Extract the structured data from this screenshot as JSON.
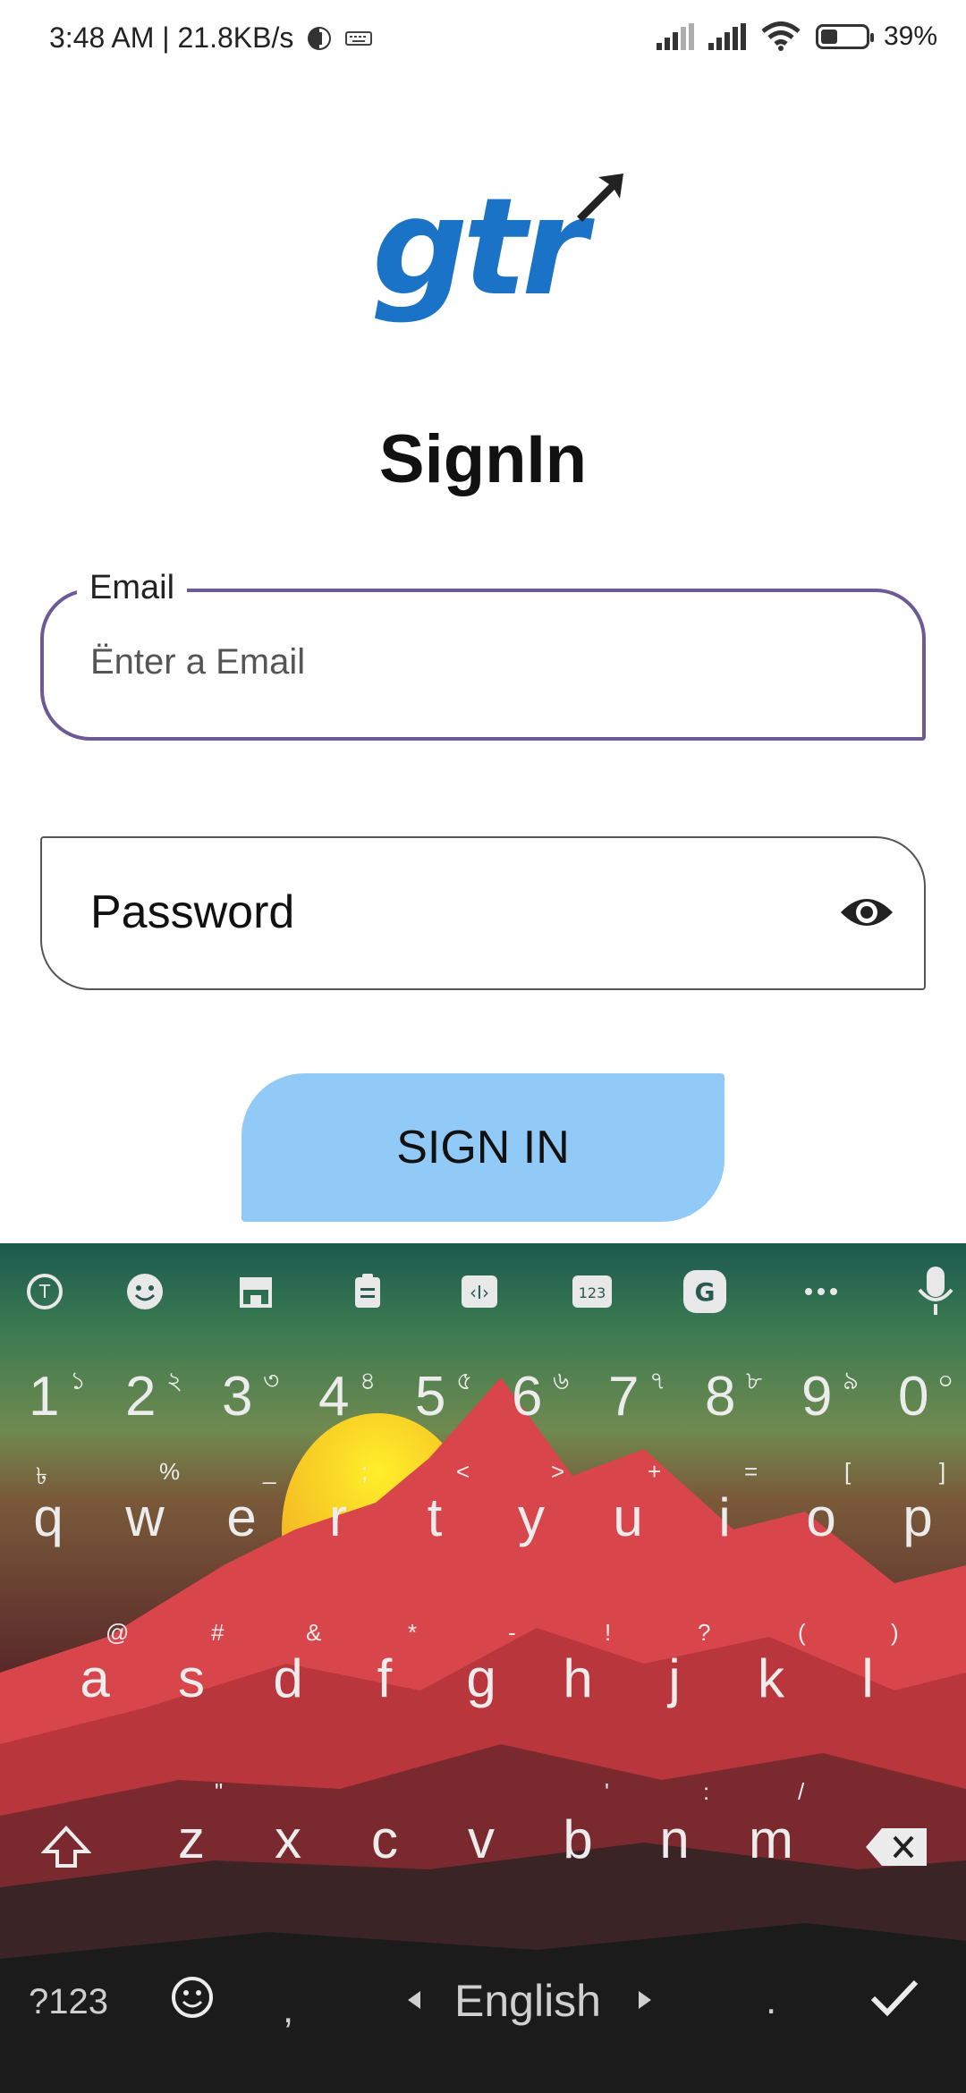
{
  "status_bar": {
    "time_speed": "3:48 AM | 21.8KB/s",
    "battery": "39%"
  },
  "logo": {
    "text": "gtr"
  },
  "page": {
    "title": "SignIn"
  },
  "email": {
    "label": "Email",
    "placeholder": "Ënter a Email"
  },
  "password": {
    "label": "Password"
  },
  "signin_button": {
    "label": "SIGN IN"
  },
  "keyboard": {
    "number_row": [
      {
        "key": "1",
        "hint": "১"
      },
      {
        "key": "2",
        "hint": "২"
      },
      {
        "key": "3",
        "hint": "৩"
      },
      {
        "key": "4",
        "hint": "৪"
      },
      {
        "key": "5",
        "hint": "৫"
      },
      {
        "key": "6",
        "hint": "৬"
      },
      {
        "key": "7",
        "hint": "৭"
      },
      {
        "key": "8",
        "hint": "৮"
      },
      {
        "key": "9",
        "hint": "৯"
      },
      {
        "key": "0",
        "hint": "০"
      }
    ],
    "row1": [
      {
        "key": "q",
        "hint": "৳"
      },
      {
        "key": "w",
        "hint": "%"
      },
      {
        "key": "e",
        "hint": "_"
      },
      {
        "key": "r",
        "hint": ";"
      },
      {
        "key": "t",
        "hint": "<"
      },
      {
        "key": "y",
        "hint": ">"
      },
      {
        "key": "u",
        "hint": "+"
      },
      {
        "key": "i",
        "hint": "="
      },
      {
        "key": "o",
        "hint": "["
      },
      {
        "key": "p",
        "hint": "]"
      }
    ],
    "row2": [
      {
        "key": "a",
        "hint": "@"
      },
      {
        "key": "s",
        "hint": "#"
      },
      {
        "key": "d",
        "hint": "&"
      },
      {
        "key": "f",
        "hint": "*"
      },
      {
        "key": "g",
        "hint": "-"
      },
      {
        "key": "h",
        "hint": "!"
      },
      {
        "key": "j",
        "hint": "?"
      },
      {
        "key": "k",
        "hint": "("
      },
      {
        "key": "l",
        "hint": ")"
      }
    ],
    "row3": [
      {
        "key": "z",
        "hint": "\""
      },
      {
        "key": "x",
        "hint": ""
      },
      {
        "key": "c",
        "hint": ""
      },
      {
        "key": "v",
        "hint": ""
      },
      {
        "key": "b",
        "hint": "'"
      },
      {
        "key": "n",
        "hint": ":"
      },
      {
        "key": "m",
        "hint": "/"
      }
    ],
    "symbols_key": "?123",
    "comma_key": ",",
    "language": "English",
    "period_key": "."
  },
  "colors": {
    "accent": "#6b5a96",
    "button": "#91c9f7",
    "logo": "#1a73c6"
  }
}
